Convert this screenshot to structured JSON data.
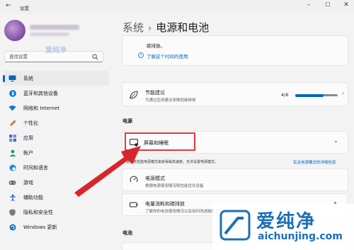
{
  "window": {
    "title": "设置",
    "back_icon": "back-arrow-icon"
  },
  "sidebar": {
    "search_placeholder": "查找设置",
    "items": [
      {
        "label": "系统",
        "icon": "monitor-icon",
        "color": "#0067c0",
        "active": true
      },
      {
        "label": "蓝牙和其他设备",
        "icon": "bluetooth-icon",
        "color": "#0078d4"
      },
      {
        "label": "网络和 Internet",
        "icon": "wifi-icon",
        "color": "#0e7bd1"
      },
      {
        "label": "个性化",
        "icon": "pen-icon",
        "color": "#c37a3a"
      },
      {
        "label": "应用",
        "icon": "apps-icon",
        "color": "#4a6cc4"
      },
      {
        "label": "帐户",
        "icon": "person-icon",
        "color": "#1aa37a"
      },
      {
        "label": "时间和语言",
        "icon": "globe-clock-icon",
        "color": "#1f8ad6"
      },
      {
        "label": "游戏",
        "icon": "gamepad-icon",
        "color": "#6b6b6b"
      },
      {
        "label": "辅助功能",
        "icon": "accessibility-icon",
        "color": "#2b6fc4"
      },
      {
        "label": "隐私和安全性",
        "icon": "shield-icon",
        "color": "#7a7a7a"
      },
      {
        "label": "Windows 更新",
        "icon": "update-icon",
        "color": "#1e73c4"
      }
    ]
  },
  "breadcrumb": {
    "parent": "系统",
    "current": "电源和电池"
  },
  "eco": {
    "text": "碳排放。",
    "link": "了解这个时间的使用"
  },
  "energy": {
    "title": "节能建议",
    "desc": "可通过应用建议来降低碳排放",
    "count": "4/6",
    "progress": 0.67
  },
  "power_section": "电源",
  "screen_sleep": {
    "title": "屏幕和睡眠"
  },
  "note": {
    "text": "使用高性能电源模式来获得最高速度，无法设置电源模式。",
    "link": "有关电源模式的详细信息"
  },
  "power_mode": {
    "title": "电源模式",
    "desc": "根据电源使用情况和性能优化设备"
  },
  "power_usage": {
    "title": "电量消耗和碳排放",
    "desc": "了解你的电池使用情况以及如何改进碳排放"
  },
  "battery_section": "电池",
  "logo": {
    "cn": "爱纯净",
    "en": "aichunjing.com"
  },
  "watermark": "爱纯净",
  "colors": {
    "accent": "#0067c0",
    "highlight": "#e0393e",
    "arrow": "#d7262b",
    "logo": "#1b6fb8"
  }
}
